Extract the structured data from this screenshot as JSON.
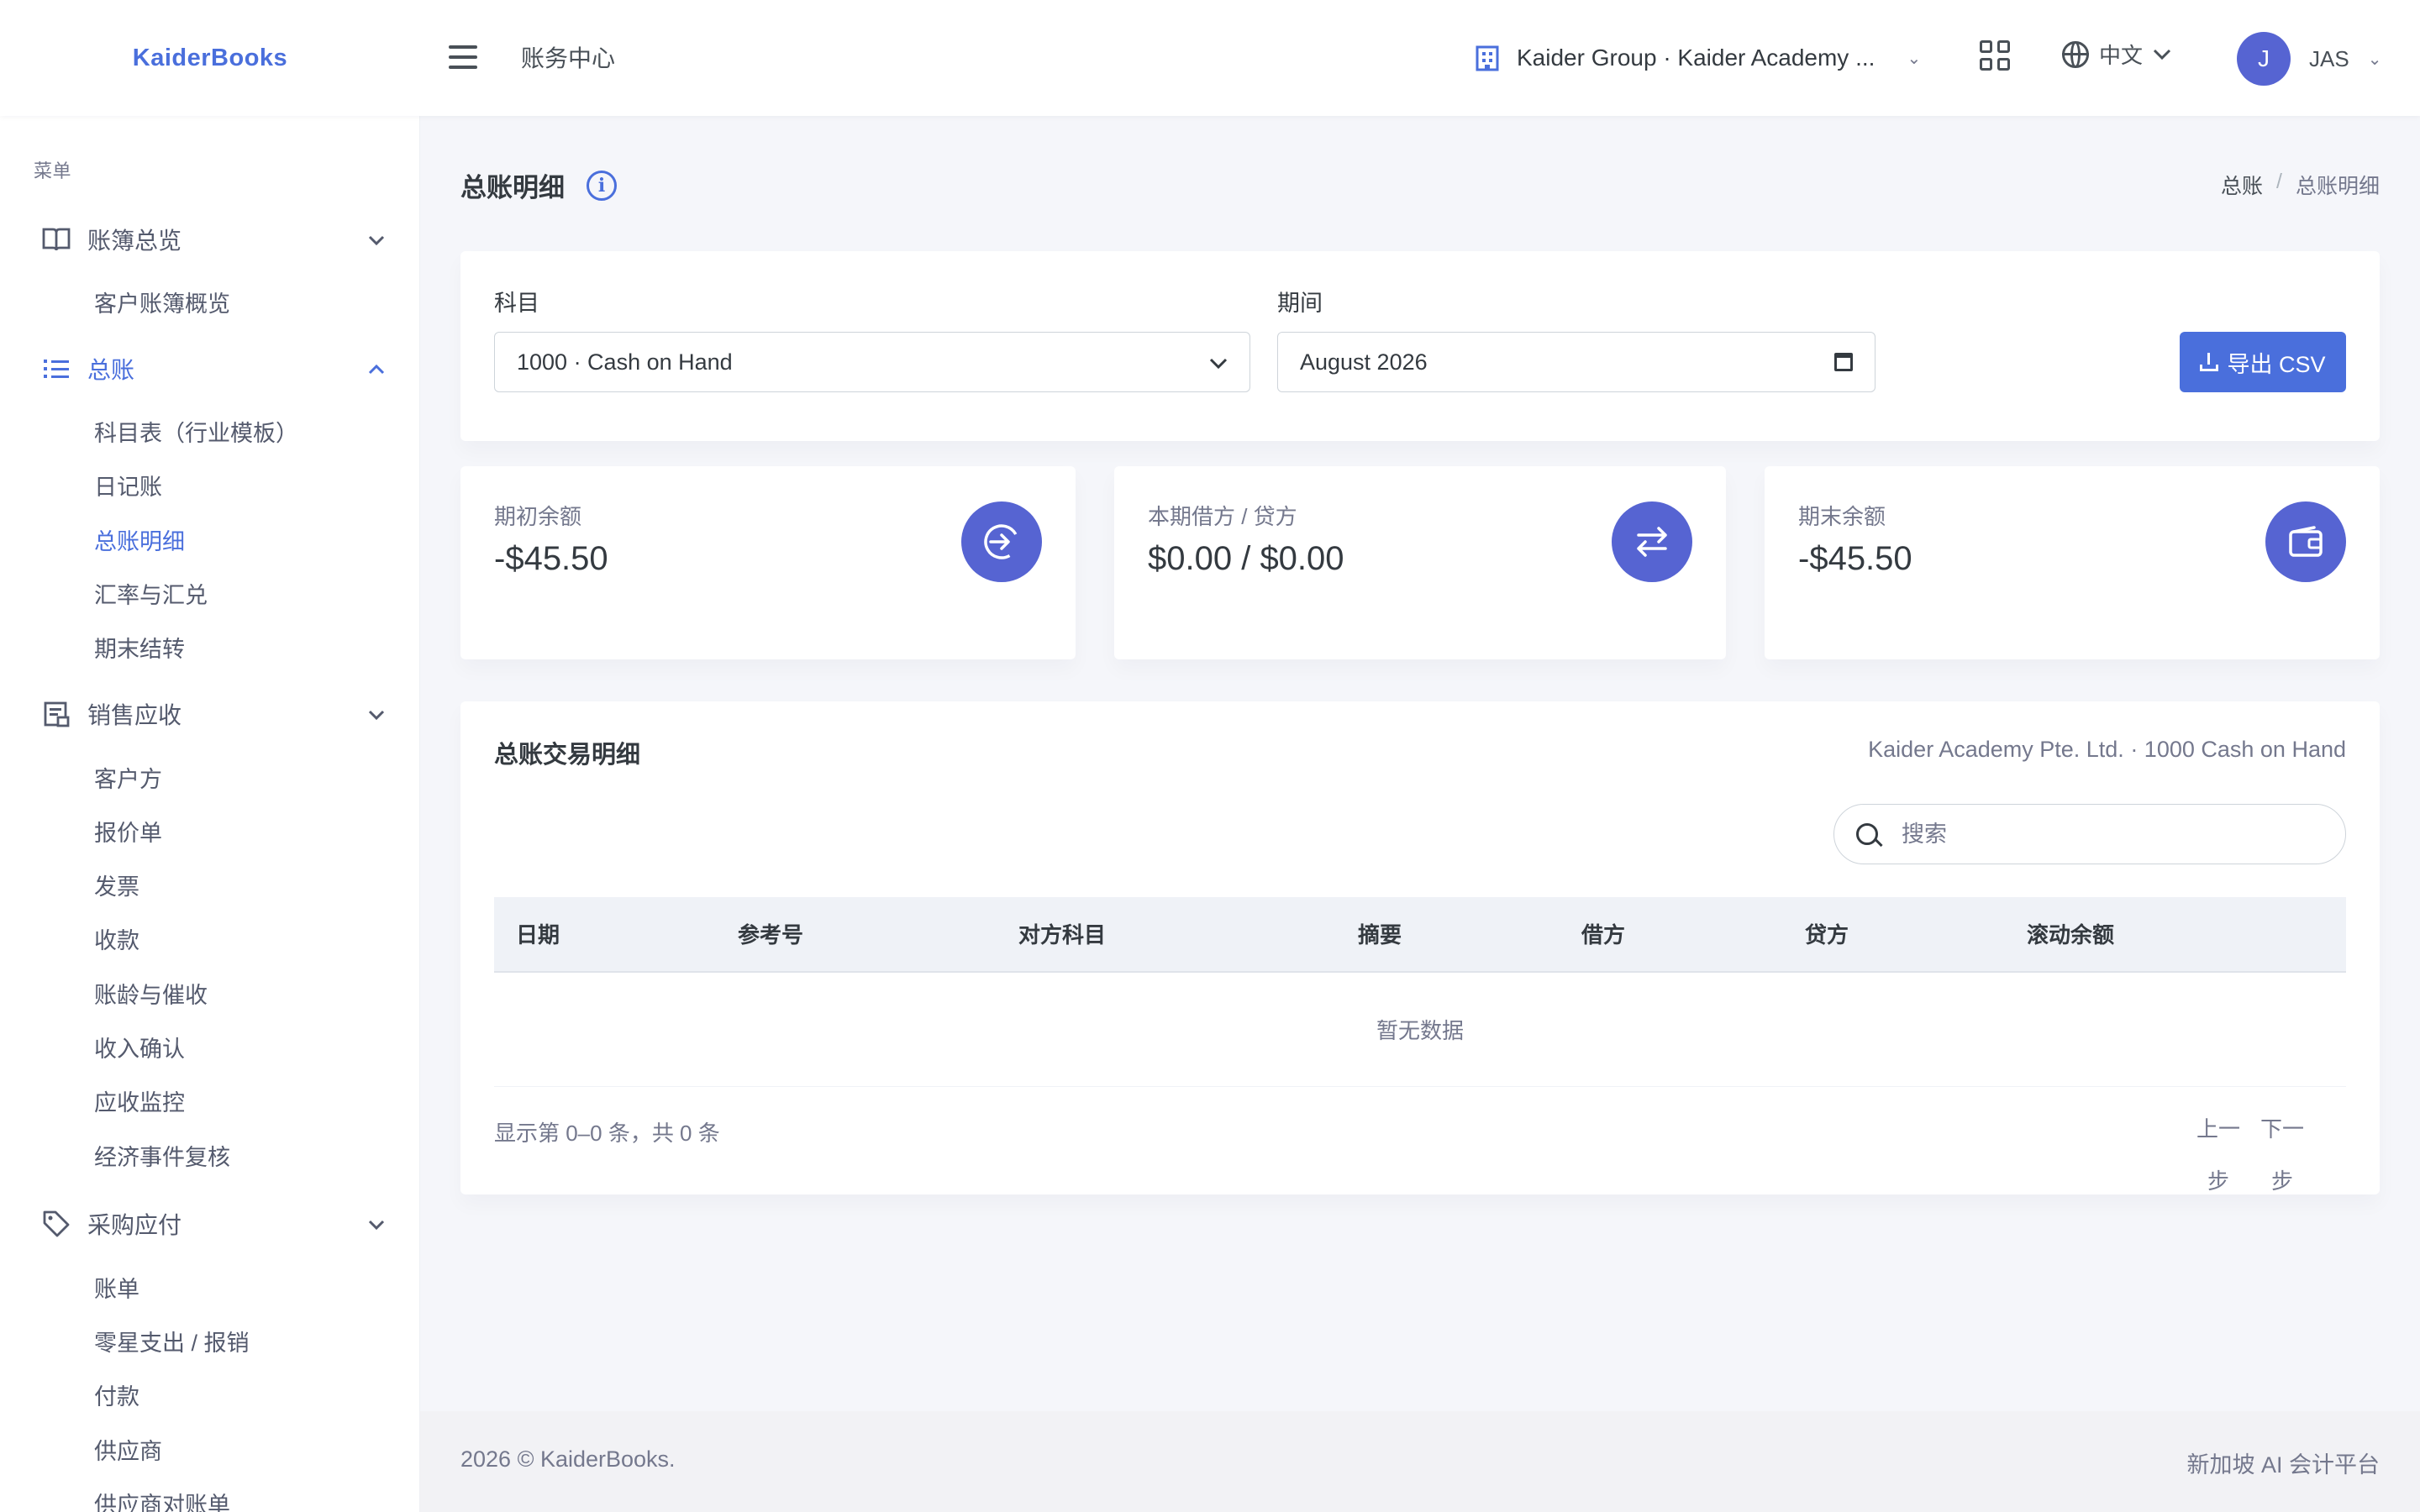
{
  "header": {
    "brand": "KaiderBooks",
    "page_heading": "账务中心",
    "org": "Kaider Group · Kaider Academy ...",
    "language": "中文",
    "avatar_initial": "J",
    "user_name": "JAS"
  },
  "sidebar": {
    "menu_title": "菜单",
    "groups": [
      {
        "label": "账簿总览",
        "icon": "book-icon",
        "expanded": true,
        "items": [
          "客户账簿概览"
        ]
      },
      {
        "label": "总账",
        "icon": "list-icon",
        "expanded": true,
        "active": true,
        "items": [
          "科目表（行业模板）",
          "日记账",
          "总账明细",
          "汇率与汇兑",
          "期末结转"
        ]
      },
      {
        "label": "销售应收",
        "icon": "receipt-icon",
        "expanded": true,
        "items": [
          "客户方",
          "报价单",
          "发票",
          "收款",
          "账龄与催收",
          "收入确认",
          "应收监控",
          "经济事件复核"
        ]
      },
      {
        "label": "采购应付",
        "icon": "tag-icon",
        "expanded": true,
        "items": [
          "账单",
          "零星支出 / 报销",
          "付款",
          "供应商",
          "供应商对账单"
        ]
      }
    ],
    "active_item": "总账明细"
  },
  "page": {
    "title": "总账明细",
    "breadcrumb": [
      "总账",
      "总账明细"
    ]
  },
  "filters": {
    "account_label": "科目",
    "account_value": "1000 · Cash on Hand",
    "period_label": "期间",
    "period_value": "August 2026",
    "export_label": "导出 CSV"
  },
  "stats": [
    {
      "label": "期初余额",
      "value": "-$45.50",
      "icon": "sign-in-icon"
    },
    {
      "label": "本期借方 / 贷方",
      "value": "$0.00 / $0.00",
      "icon": "transfer-icon"
    },
    {
      "label": "期末余额",
      "value": "-$45.50",
      "icon": "wallet-icon"
    }
  ],
  "table": {
    "title": "总账交易明细",
    "subtitle": "Kaider Academy Pte. Ltd. · 1000 Cash on Hand",
    "search_placeholder": "搜索",
    "columns": [
      "日期",
      "参考号",
      "对方科目",
      "摘要",
      "借方",
      "贷方",
      "滚动余额"
    ],
    "empty_text": "暂无数据",
    "info": "显示第 0–0 条，共 0 条",
    "prev_label": "上一步",
    "next_label": "下一步"
  },
  "footer": {
    "left": "2026 © KaiderBooks.",
    "right": "新加坡 AI 会计平台"
  },
  "colors": {
    "accent": "#4a6fdc",
    "icon_circle": "#5664d2",
    "text": "#495057",
    "muted": "#74788d"
  }
}
